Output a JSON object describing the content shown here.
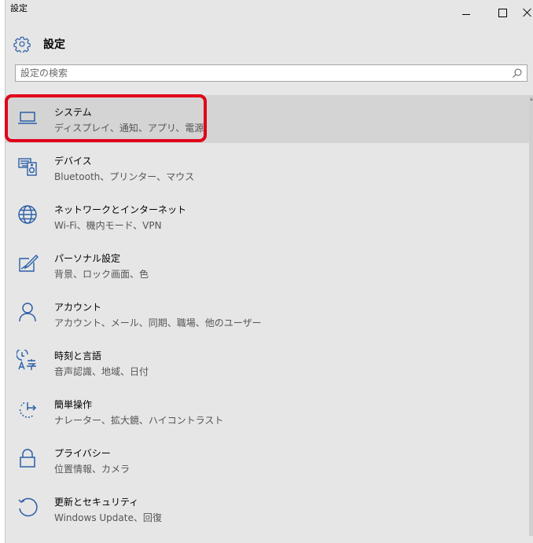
{
  "window": {
    "title": "設定",
    "minimize_label": "",
    "maximize_label": "",
    "close_label": ""
  },
  "header": {
    "title": "設定",
    "icon": "gear-icon"
  },
  "search": {
    "placeholder": "設定の検索",
    "value": "",
    "icon": "search-icon"
  },
  "colors": {
    "background": "#e6e6e6",
    "selected": "#d4d4d4",
    "highlight_border": "#e0001a"
  },
  "items": [
    {
      "name": "システム",
      "desc": "ディスプレイ、通知、アプリ、電源",
      "icon": "laptop-icon",
      "selected": true
    },
    {
      "name": "デバイス",
      "desc": "Bluetooth、プリンター、マウス",
      "icon": "keyboard-speaker-icon"
    },
    {
      "name": "ネットワークとインターネット",
      "desc": "Wi-Fi、機内モード、VPN",
      "icon": "globe-icon"
    },
    {
      "name": "パーソナル設定",
      "desc": "背景、ロック画面、色",
      "icon": "personalize-pen-icon"
    },
    {
      "name": "アカウント",
      "desc": "アカウント、メール、同期、職場、他のユーザー",
      "icon": "person-icon"
    },
    {
      "name": "時刻と言語",
      "desc": "音声認識、地域、日付",
      "icon": "time-language-icon"
    },
    {
      "name": "簡単操作",
      "desc": "ナレーター、拡大鏡、ハイコントラスト",
      "icon": "ease-of-access-icon"
    },
    {
      "name": "プライバシー",
      "desc": "位置情報、カメラ",
      "icon": "lock-icon"
    },
    {
      "name": "更新とセキュリティ",
      "desc": "Windows Update、回復",
      "icon": "update-icon"
    }
  ]
}
